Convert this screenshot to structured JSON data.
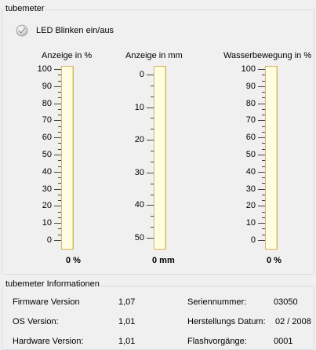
{
  "groups": {
    "tubemeter": "tubemeter",
    "info": "tubemeter Informationen"
  },
  "checkbox": {
    "label": "LED Blinken ein/aus",
    "checked": true
  },
  "gauges": [
    {
      "label": "Anzeige in %",
      "value_text": "0 %",
      "value": 0,
      "max": 100,
      "ticks": [
        "100",
        "90",
        "80",
        "70",
        "60",
        "50",
        "40",
        "30",
        "20",
        "10",
        "0"
      ]
    },
    {
      "label": "Anzeige in mm",
      "value_text": "0 mm",
      "value": 0,
      "max": 55,
      "ticks": [
        "50",
        "40",
        "30",
        "20",
        "10",
        "0"
      ]
    },
    {
      "label": "Wasserbewegung in %",
      "value_text": "0 %",
      "value": 0,
      "max": 100,
      "ticks": [
        "100",
        "90",
        "80",
        "70",
        "60",
        "50",
        "40",
        "30",
        "20",
        "10",
        "0"
      ]
    }
  ],
  "info": {
    "firmware_label": "Firmware Version",
    "firmware_value": "1,07",
    "os_label": "OS Version:",
    "os_value": "1,01",
    "hardware_label": "Hardware Version:",
    "hardware_value": "1,01",
    "serial_label": "Seriennummer:",
    "serial_value": "03050",
    "date_label": "Herstellungs Datum:",
    "date_value": "02 / 2008",
    "flash_label": "Flashvorgänge:",
    "flash_value": "0001"
  },
  "colors": {
    "tube_bg": "#fffde0",
    "tube_border": "#d8b45c",
    "fill": "#e9b04e"
  }
}
